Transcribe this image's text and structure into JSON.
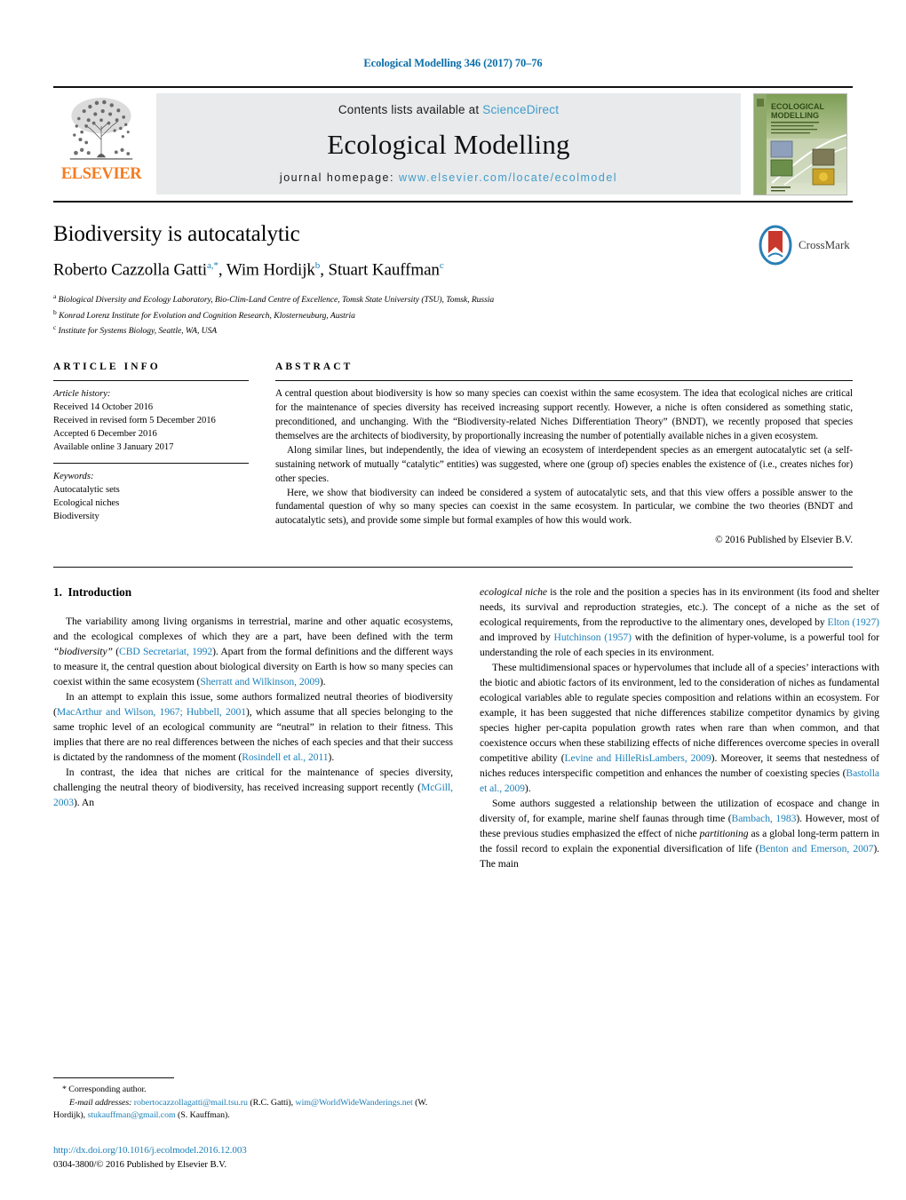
{
  "running_head": "Ecological Modelling 346 (2017) 70–76",
  "masthead": {
    "publisher_name": "ELSEVIER",
    "contents_prefix": "Contents lists available at ",
    "contents_link": "ScienceDirect",
    "journal_title": "Ecological Modelling",
    "homepage_prefix": "journal homepage: ",
    "homepage_url": "www.elsevier.com/locate/ecolmodel",
    "cover_title_line1": "ECOLOGICAL",
    "cover_title_line2": "MODELLING",
    "cover_sub": "AN INTERNATIONAL JOURNAL ON ECOLOGICAL MODELLING AND SYSTEMS ECOLOGY",
    "cover_footer": "Editor-in-Chief\nBrian D. Fath"
  },
  "article": {
    "title": "Biodiversity is autocatalytic",
    "authors": [
      {
        "name": "Roberto Cazzolla Gatti",
        "marks": "a,*"
      },
      {
        "name": "Wim Hordijk",
        "marks": "b"
      },
      {
        "name": "Stuart Kauffman",
        "marks": "c"
      }
    ],
    "authors_line_plain": "Roberto Cazzolla Gatti, Wim Hordijk, Stuart Kauffman",
    "affiliations": [
      {
        "mark": "a",
        "text": "Biological Diversity and Ecology Laboratory, Bio-Clim-Land Centre of Excellence, Tomsk State University (TSU), Tomsk, Russia"
      },
      {
        "mark": "b",
        "text": "Konrad Lorenz Institute for Evolution and Cognition Research, Klosterneuburg, Austria"
      },
      {
        "mark": "c",
        "text": "Institute for Systems Biology, Seattle, WA, USA"
      }
    ],
    "crossmark_label": "CrossMark"
  },
  "article_info": {
    "heading": "ARTICLE INFO",
    "history_label": "Article history:",
    "history": [
      "Received 14 October 2016",
      "Received in revised form 5 December 2016",
      "Accepted 6 December 2016",
      "Available online 3 January 2017"
    ],
    "keywords_label": "Keywords:",
    "keywords": [
      "Autocatalytic sets",
      "Ecological niches",
      "Biodiversity"
    ]
  },
  "abstract": {
    "heading": "ABSTRACT",
    "paragraphs": [
      "A central question about biodiversity is how so many species can coexist within the same ecosystem. The idea that ecological niches are critical for the maintenance of species diversity has received increasing support recently. However, a niche is often considered as something static, preconditioned, and unchanging. With the “Biodiversity-related Niches Differentiation Theory” (BNDT), we recently proposed that species themselves are the architects of biodiversity, by proportionally increasing the number of potentially available niches in a given ecosystem.",
      "Along similar lines, but independently, the idea of viewing an ecosystem of interdependent species as an emergent autocatalytic set (a self-sustaining network of mutually “catalytic” entities) was suggested, where one (group of) species enables the existence of (i.e., creates niches for) other species.",
      "Here, we show that biodiversity can indeed be considered a system of autocatalytic sets, and that this view offers a possible answer to the fundamental question of why so many species can coexist in the same ecosystem. In particular, we combine the two theories (BNDT and autocatalytic sets), and provide some simple but formal examples of how this would work."
    ],
    "copyright": "© 2016 Published by Elsevier B.V."
  },
  "introduction": {
    "section_number": "1.",
    "section_title": "Introduction",
    "left_paragraphs": [
      {
        "parts": [
          {
            "t": "The variability among living organisms in terrestrial, marine and other aquatic ecosystems, and the ecological complexes of which they are a part, have been defined with the term ",
            "s": "plain"
          },
          {
            "t": "“biodiversity”",
            "s": "italic"
          },
          {
            "t": " (",
            "s": "plain"
          },
          {
            "t": "CBD Secretariat, 1992",
            "s": "ref"
          },
          {
            "t": "). Apart from the formal definitions and the different ways to measure it, the central question about biological diversity on Earth is how so many species can coexist within the same ecosystem (",
            "s": "plain"
          },
          {
            "t": "Sherratt and Wilkinson, 2009",
            "s": "ref"
          },
          {
            "t": ").",
            "s": "plain"
          }
        ]
      },
      {
        "parts": [
          {
            "t": "In an attempt to explain this issue, some authors formalized neutral theories of biodiversity (",
            "s": "plain"
          },
          {
            "t": "MacArthur and Wilson, 1967; Hubbell, 2001",
            "s": "ref"
          },
          {
            "t": "), which assume that all species belonging to the same trophic level of an ecological community are “neutral” in relation to their fitness. This implies that there are no real differences between the niches of each species and that their success is dictated by the randomness of the moment (",
            "s": "plain"
          },
          {
            "t": "Rosindell et al., 2011",
            "s": "ref"
          },
          {
            "t": ").",
            "s": "plain"
          }
        ]
      },
      {
        "parts": [
          {
            "t": "In contrast, the idea that niches are critical for the maintenance of species diversity, challenging the neutral theory of biodiversity, has received increasing support recently (",
            "s": "plain"
          },
          {
            "t": "McGill, 2003",
            "s": "ref"
          },
          {
            "t": "). An",
            "s": "plain"
          }
        ]
      }
    ],
    "right_paragraphs": [
      {
        "parts": [
          {
            "t": "ecological niche",
            "s": "italic"
          },
          {
            "t": " is the role and the position a species has in its environment (its food and shelter needs, its survival and reproduction strategies, etc.). The concept of a niche as the set of ecological requirements, from the reproductive to the alimentary ones, developed by ",
            "s": "plain"
          },
          {
            "t": "Elton (1927)",
            "s": "ref"
          },
          {
            "t": " and improved by ",
            "s": "plain"
          },
          {
            "t": "Hutchinson (1957)",
            "s": "ref"
          },
          {
            "t": " with the definition of hyper-volume, is a powerful tool for understanding the role of each species in its environment.",
            "s": "plain"
          }
        ]
      },
      {
        "parts": [
          {
            "t": "These multidimensional spaces or hypervolumes that include all of a species’ interactions with the biotic and abiotic factors of its environment, led to the consideration of niches as fundamental ecological variables able to regulate species composition and relations within an ecosystem. For example, it has been suggested that niche differences stabilize competitor dynamics by giving species higher per-capita population growth rates when rare than when common, and that coexistence occurs when these stabilizing effects of niche differences overcome species in overall competitive ability (",
            "s": "plain"
          },
          {
            "t": "Levine and HilleRisLambers, 2009",
            "s": "ref"
          },
          {
            "t": "). Moreover, it seems that nestedness of niches reduces interspecific competition and enhances the number of coexisting species (",
            "s": "plain"
          },
          {
            "t": "Bastolla et al., 2009",
            "s": "ref"
          },
          {
            "t": ").",
            "s": "plain"
          }
        ]
      },
      {
        "parts": [
          {
            "t": "Some authors suggested a relationship between the utilization of ecospace and change in diversity of, for example, marine shelf faunas through time (",
            "s": "plain"
          },
          {
            "t": "Bambach, 1983",
            "s": "ref"
          },
          {
            "t": "). However, most of these previous studies emphasized the effect of niche ",
            "s": "plain"
          },
          {
            "t": "partitioning",
            "s": "italic"
          },
          {
            "t": " as a global long-term pattern in the fossil record to explain the exponential diversification of life (",
            "s": "plain"
          },
          {
            "t": "Benton and Emerson, 2007",
            "s": "ref"
          },
          {
            "t": "). The main",
            "s": "plain"
          }
        ]
      }
    ]
  },
  "footnotes": {
    "corresponding": "* Corresponding author.",
    "email_label": "E-mail addresses:",
    "emails": [
      {
        "address": "robertocazzollagatti@mail.tsu.ru",
        "owner": "(R.C. Gatti)"
      },
      {
        "address": "wim@WorldWideWanderings.net",
        "owner": "(W. Hordijk)"
      },
      {
        "address": "stukauffman@gmail.com",
        "owner": "(S. Kauffman)"
      }
    ],
    "doi": "http://dx.doi.org/10.1016/j.ecolmodel.2016.12.003",
    "issn_line": "0304-3800/© 2016 Published by Elsevier B.V."
  },
  "colors": {
    "link_blue": "#1b7fb8",
    "header_blue": "#0b6ea8",
    "sciencedirect_blue": "#3e9ccc",
    "elsevier_orange": "#f57c20",
    "banner_gray": "#e9eaeb"
  }
}
